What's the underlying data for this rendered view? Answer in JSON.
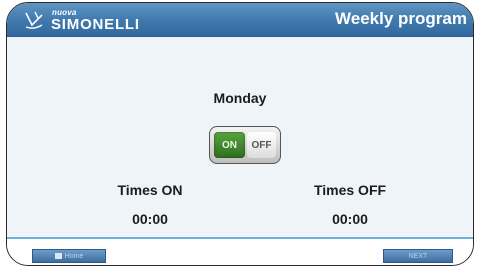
{
  "header": {
    "brand_small": "nuova",
    "brand_name": "SIMONELLI",
    "title": "Weekly program"
  },
  "program": {
    "day": "Monday",
    "toggle": {
      "on_label": "ON",
      "off_label": "OFF",
      "state": "ON"
    },
    "times_on_label": "Times ON",
    "times_off_label": "Times OFF",
    "times_on_value": "00:00",
    "times_off_value": "00:00"
  },
  "footer": {
    "home_label": "Home",
    "next_label": "NEXT"
  },
  "colors": {
    "header_blue": "#3f78ad",
    "toggle_on_green": "#3f8a2c",
    "content_bg": "#eef4f8",
    "footer_accent": "#6fb0dc"
  }
}
